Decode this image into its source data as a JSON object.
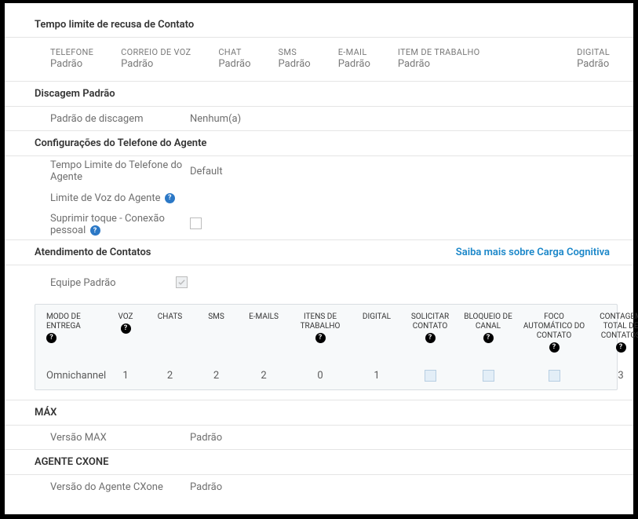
{
  "refusal": {
    "title": "Tempo limite de recusa de Contato",
    "items": [
      {
        "label": "TELEFONE",
        "value": "Padrão"
      },
      {
        "label": "CORREIO DE VOZ",
        "value": "Padrão"
      },
      {
        "label": "CHAT",
        "value": "Padrão"
      },
      {
        "label": "SMS",
        "value": "Padrão"
      },
      {
        "label": "E-MAIL",
        "value": "Padrão"
      },
      {
        "label": "ITEM DE TRABALHO",
        "value": "Padrão"
      },
      {
        "label": "DIGITAL",
        "value": "Padrão"
      }
    ]
  },
  "dialing": {
    "title": "Discagem Padrão",
    "pattern_label": "Padrão de discagem",
    "pattern_value": "Nenhum(a)"
  },
  "agentPhone": {
    "title": "Configurações do Telefone do Agente",
    "timeout_label": "Tempo Limite do Telefone do Agente",
    "timeout_value": "Default",
    "voice_limit_label": "Limite de Voz do Agente",
    "suppress_label": "Suprimir toque - Conexão pessoal"
  },
  "contactHandling": {
    "title": "Atendimento de Contatos",
    "link": "Saiba mais sobre Carga Cognitiva",
    "default_team_label": "Equipe Padrão",
    "headers": {
      "mode": "MODO DE ENTREGA",
      "voice": "VOZ",
      "chats": "CHATS",
      "sms": "SMS",
      "emails": "E-MAILS",
      "workitems": "ITENS DE TRABALHO",
      "digital": "DIGITAL",
      "request": "SOLICITAR CONTATO",
      "lock": "BLOQUEIO DE CANAL",
      "autofocus": "FOCO AUTOMÁTICO DO CONTATO",
      "total": "CONTAGEM TOTAL DE CONTATOS"
    },
    "row": {
      "mode": "Omnichannel",
      "voice": "1",
      "chats": "2",
      "sms": "2",
      "emails": "2",
      "workitems": "0",
      "digital": "1",
      "total": "3"
    }
  },
  "max": {
    "title": "MÁX",
    "label": "Versão MAX",
    "value": "Padrão"
  },
  "cxone": {
    "title": "AGENTE CXONE",
    "label": "Versão do Agente CXone",
    "value": "Padrão"
  }
}
